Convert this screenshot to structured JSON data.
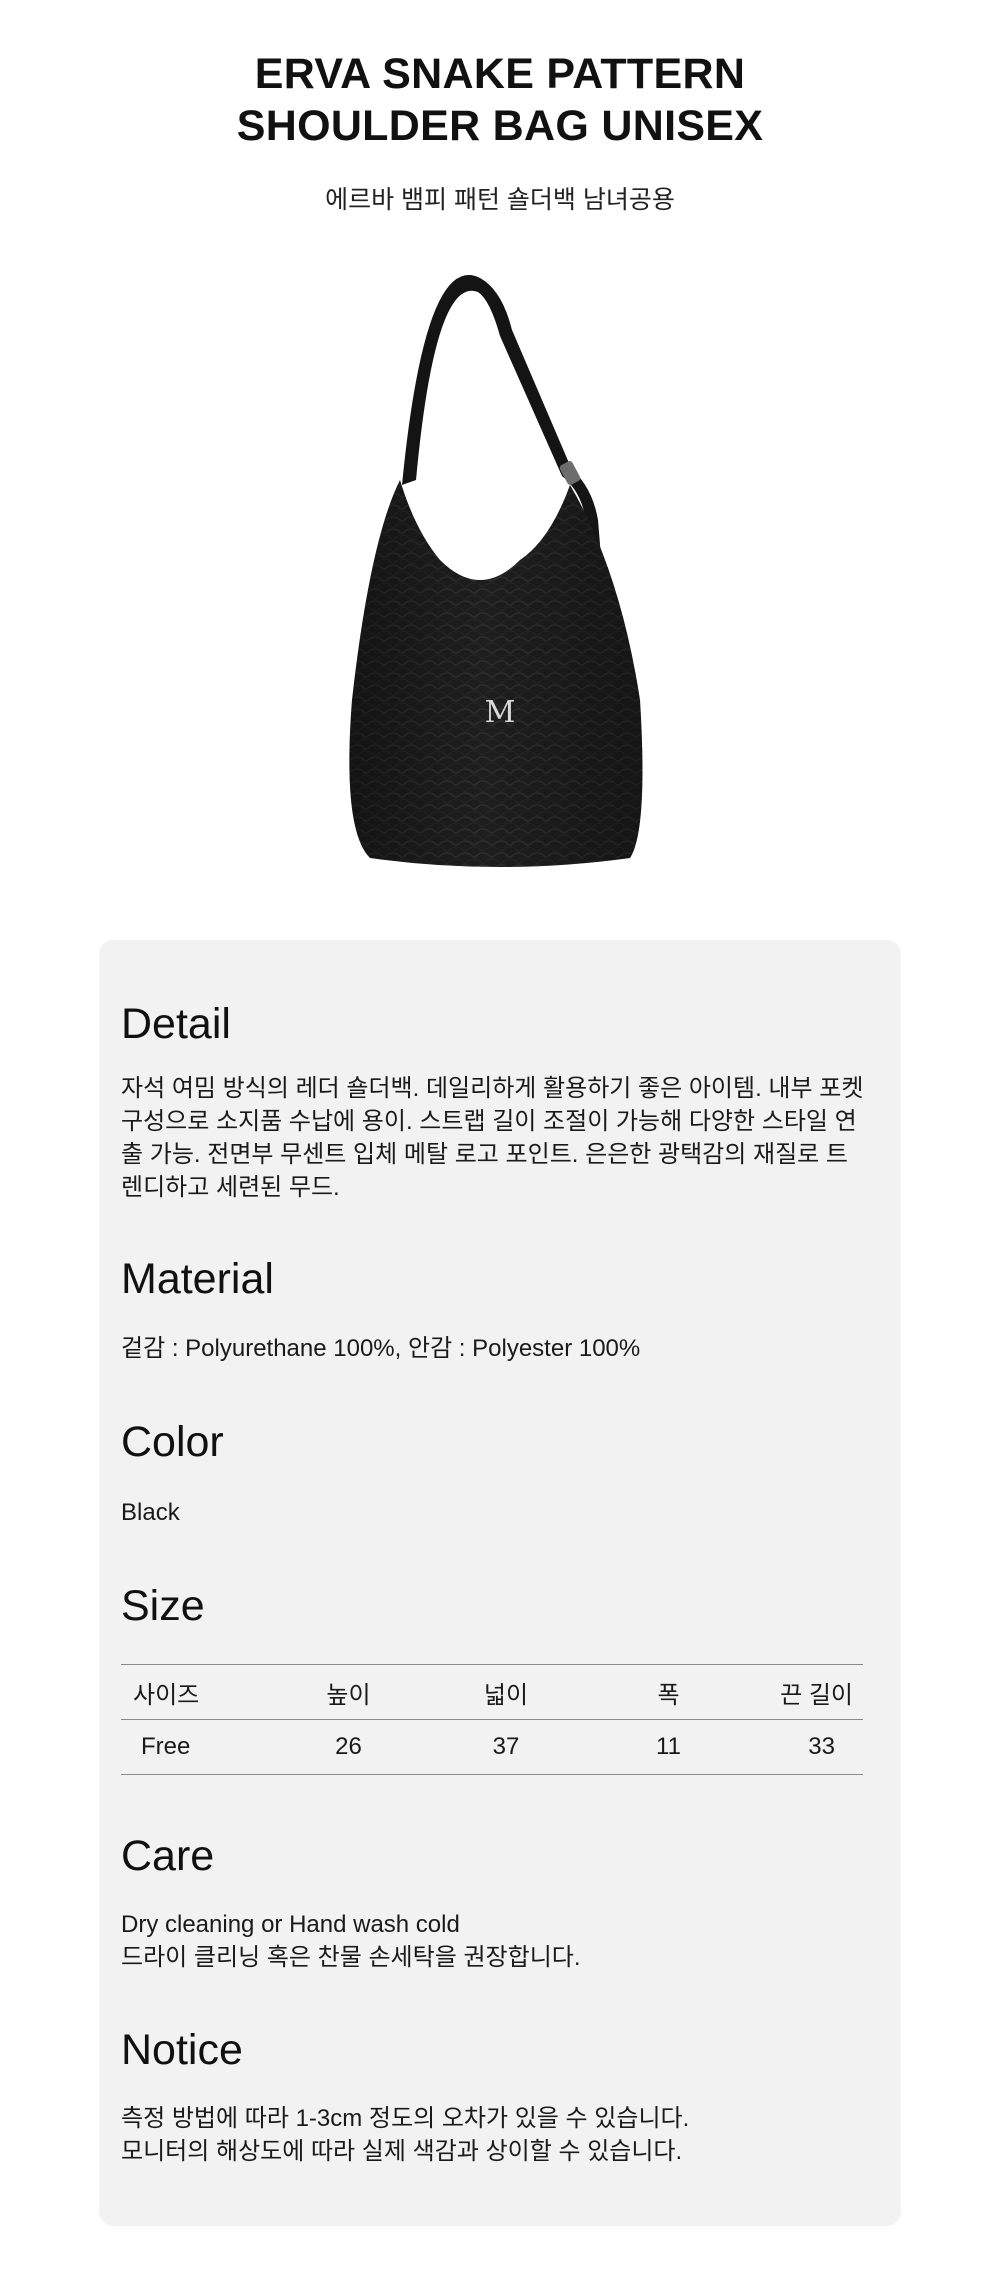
{
  "header": {
    "title_line1": "ERVA SNAKE PATTERN",
    "title_line2": "SHOULDER BAG UNISEX",
    "subtitle": "에르바 뱀피 패턴 숄더백 남녀공용"
  },
  "product": {
    "logo_letter": "M",
    "color_hex": "#1c1c1c"
  },
  "detail": {
    "heading": "Detail",
    "lines": [
      "자석 여밈 방식의 레더 숄더백. 데일리하게 활용하기 좋은 아이템. 내부 포켓",
      "구성으로 소지품 수납에 용이. 스트랩 길이 조절이 가능해 다양한 스타일 연",
      "출 가능. 전면부 무센트 입체 메탈 로고 포인트. 은은한 광택감의 재질로 트",
      "렌디하고 세련된 무드."
    ]
  },
  "material": {
    "heading": "Material",
    "text": "겉감 : Polyurethane 100%, 안감 : Polyester 100%"
  },
  "color": {
    "heading": "Color",
    "text": "Black"
  },
  "size": {
    "heading": "Size",
    "headers": [
      "사이즈",
      "높이",
      "넓이",
      "폭",
      "끈 길이"
    ],
    "row": [
      "Free",
      "26",
      "37",
      "11",
      "33"
    ]
  },
  "care": {
    "heading": "Care",
    "line1": "Dry cleaning or Hand wash cold",
    "line2": "드라이 클리닝 혹은 찬물 손세탁을 권장합니다."
  },
  "notice": {
    "heading": "Notice",
    "line1": "측정 방법에 따라 1-3cm 정도의 오차가 있을 수 있습니다.",
    "line2": "모니터의 해상도에 따라 실제 색감과 상이할 수 있습니다."
  }
}
